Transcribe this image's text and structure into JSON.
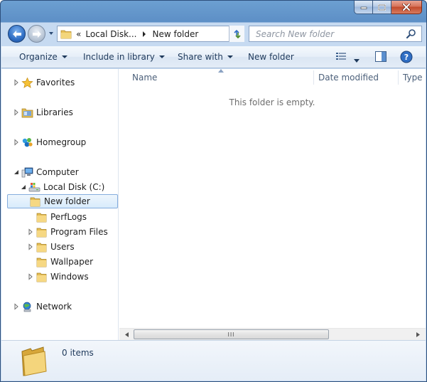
{
  "address": {
    "prefix": "«",
    "segment1": "Local Disk...",
    "segment2": "New folder"
  },
  "search": {
    "placeholder": "Search New folder"
  },
  "commands": {
    "organize": "Organize",
    "include_in_library": "Include in library",
    "share_with": "Share with",
    "new_folder": "New folder"
  },
  "nav": {
    "favorites": "Favorites",
    "libraries": "Libraries",
    "homegroup": "Homegroup",
    "computer": "Computer",
    "local_disk": "Local Disk (C:)",
    "folders": [
      "New folder",
      "PerfLogs",
      "Program Files",
      "Users",
      "Wallpaper",
      "Windows"
    ],
    "network": "Network"
  },
  "columns": {
    "name": "Name",
    "date_modified": "Date modified",
    "type": "Type"
  },
  "file_list": {
    "empty_message": "This folder is empty."
  },
  "scrollbar": {
    "grip": "III"
  },
  "details": {
    "item_count": "0 items"
  },
  "colors": {
    "accent": "#1e395b",
    "selection_border": "#84acdd",
    "window_frame": "#6c9fd1"
  }
}
